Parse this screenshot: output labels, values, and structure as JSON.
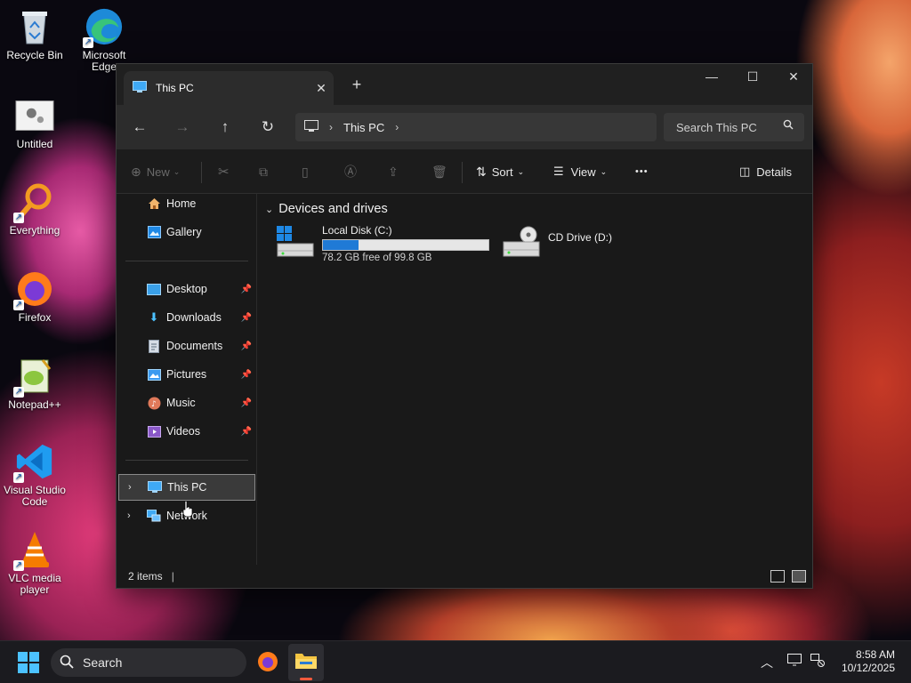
{
  "desktop": {
    "icons": [
      {
        "label": "Recycle Bin",
        "icon": "recycle-bin-icon"
      },
      {
        "label": "Microsoft Edge",
        "icon": "edge-icon"
      },
      {
        "label": "Untitled",
        "icon": "untitled-icon"
      },
      {
        "label": "Everything",
        "icon": "everything-icon"
      },
      {
        "label": "Firefox",
        "icon": "firefox-icon"
      },
      {
        "label": "Notepad++",
        "icon": "notepad-plus-plus-icon"
      },
      {
        "label": "Visual Studio Code",
        "icon": "vscode-icon"
      },
      {
        "label": "VLC media player",
        "icon": "vlc-icon"
      }
    ]
  },
  "window": {
    "tab_title": "This PC",
    "tab_close": "✕",
    "new_tab": "+",
    "minimize": "—",
    "maximize": "☐",
    "close": "✕"
  },
  "navbar": {
    "back": "←",
    "forward": "→",
    "up": "↑",
    "refresh": "↻",
    "breadcrumb": "This PC",
    "search_placeholder": "Search This PC"
  },
  "toolbar": {
    "new_label": "New",
    "sort_label": "Sort",
    "view_label": "View",
    "more_label": "•••",
    "details_label": "Details"
  },
  "sidebar": {
    "quick": [
      {
        "label": "Home"
      },
      {
        "label": "Gallery"
      }
    ],
    "pinned": [
      {
        "label": "Desktop"
      },
      {
        "label": "Downloads"
      },
      {
        "label": "Documents"
      },
      {
        "label": "Pictures"
      },
      {
        "label": "Music"
      },
      {
        "label": "Videos"
      }
    ],
    "locations": [
      {
        "label": "This PC",
        "selected": true
      },
      {
        "label": "Network",
        "selected": false
      }
    ]
  },
  "content": {
    "group_title": "Devices and drives",
    "drives": [
      {
        "name": "Local Disk (C:)",
        "free_text": "78.2 GB free of 99.8 GB",
        "used_fraction": 0.216
      },
      {
        "name": "CD Drive (D:)"
      }
    ]
  },
  "status": {
    "item_count": "2 items"
  },
  "taskbar": {
    "search_label": "Search",
    "time": "8:58 AM",
    "date": "10/12/2025"
  },
  "colors": {
    "accent": "#1f7ad6",
    "window_bg": "#191919",
    "toolbar_bg": "#2c2c2c"
  }
}
